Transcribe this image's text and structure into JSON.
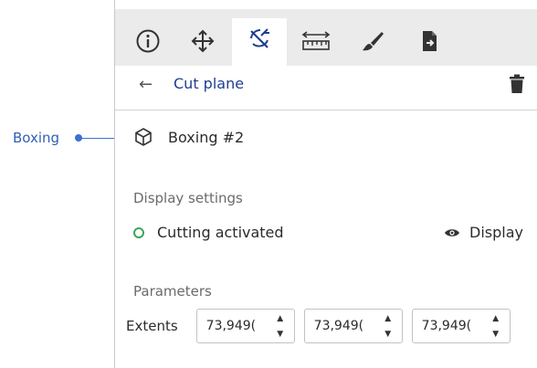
{
  "annotation": {
    "label": "Boxing"
  },
  "toolbar": {
    "tools": [
      {
        "name": "info-icon"
      },
      {
        "name": "move-icon"
      },
      {
        "name": "cut-plane-icon",
        "active": true
      },
      {
        "name": "ruler-icon"
      },
      {
        "name": "brush-icon"
      },
      {
        "name": "export-document-icon"
      }
    ]
  },
  "header": {
    "back_icon": "←",
    "title": "Cut plane"
  },
  "object": {
    "name": "Boxing #2"
  },
  "display_settings": {
    "label": "Display settings",
    "cutting_label": "Cutting activated",
    "display_label": "Display"
  },
  "parameters": {
    "label": "Parameters",
    "extents_label": "Extents",
    "extents": [
      "73,949(",
      "73,949(",
      "73,949("
    ]
  },
  "colors": {
    "accent": "#1f3f8f",
    "callout": "#3d6fd0",
    "status_active": "#3aa65a",
    "toolbar_bg": "#ebebeb"
  }
}
